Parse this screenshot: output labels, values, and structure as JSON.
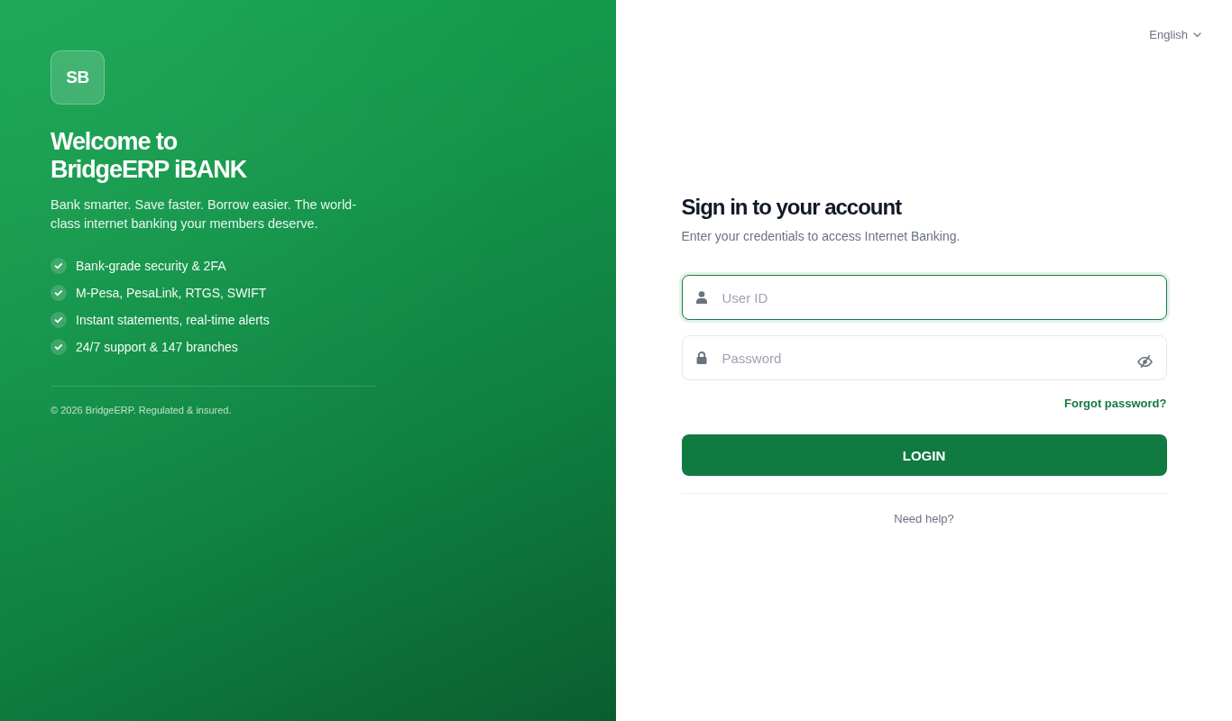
{
  "brand": {
    "logo": "SB",
    "title": "Welcome to BridgeERP iBANK",
    "tagline": "Bank smarter. Save faster. Borrow easier. The world-class internet banking your members deserve."
  },
  "features": [
    "Bank-grade security & 2FA",
    "M-Pesa, PesaLink, RTGS, SWIFT",
    "Instant statements, real-time alerts",
    "24/7 support & 147 branches"
  ],
  "copyright": "© 2026 BridgeERP. Regulated & insured.",
  "language": {
    "value": "English"
  },
  "form": {
    "title": "Sign in to your account",
    "subtitle": "Enter your credentials to access Internet Banking.",
    "fields": [
      {
        "kind": "user",
        "placeholder": "User ID",
        "focused": true
      },
      {
        "kind": "password",
        "placeholder": "Password",
        "focused": false
      }
    ],
    "forgot_link": "Forgot password?",
    "submit": "LOGIN",
    "help_link": "Need help?"
  }
}
